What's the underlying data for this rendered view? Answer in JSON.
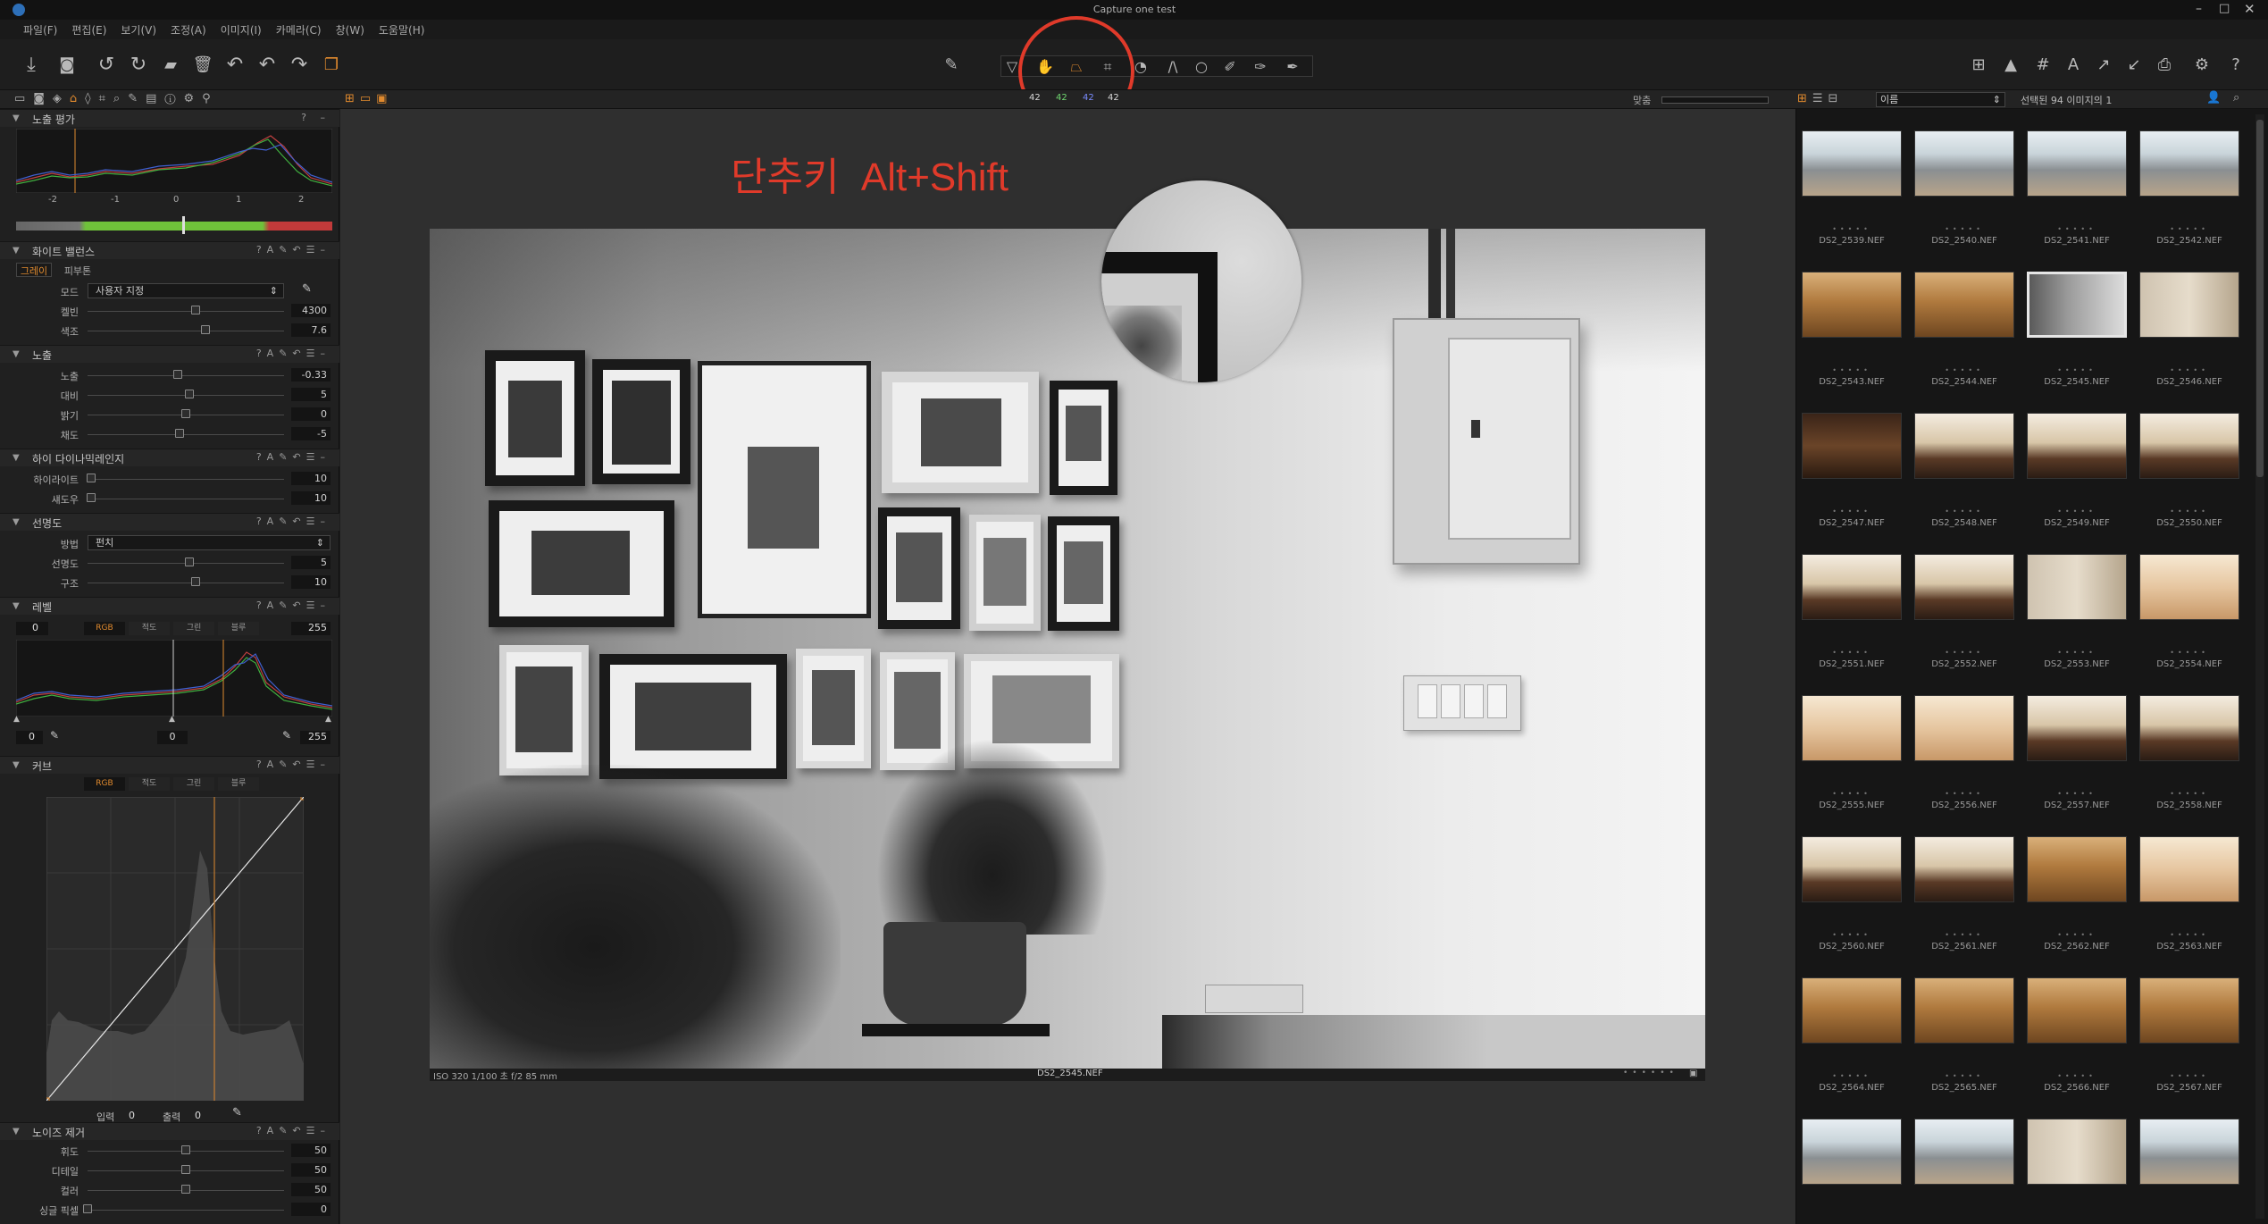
{
  "app": {
    "title": "Capture one test"
  },
  "menu": [
    "파일(F)",
    "편집(E)",
    "보기(V)",
    "조정(A)",
    "이미지(I)",
    "카메라(C)",
    "창(W)",
    "도움말(H)"
  ],
  "cursor_readouts": [
    "42",
    "42",
    "42",
    "42"
  ],
  "overlay_text": "단추키  Alt+Shift",
  "colors": {
    "accent": "#e08a2e",
    "annotation_red": "#e03a2a",
    "panel_bg": "#202020",
    "viewer_bg": "#2f2f2f"
  },
  "left_panel": {
    "exposure_eval": {
      "title": "노출 평가",
      "scale": [
        "-2",
        "-1",
        "0",
        "1",
        "2"
      ]
    },
    "white_balance": {
      "title": "화이트 밸런스",
      "tabs": [
        "그레이",
        "피부톤"
      ],
      "mode_label": "모드",
      "mode_value": "사용자 지정",
      "rows": [
        {
          "label": "켈빈",
          "value": "4300",
          "pos": 0.55
        },
        {
          "label": "색조",
          "value": "7.6",
          "pos": 0.6
        }
      ]
    },
    "exposure": {
      "title": "노출",
      "rows": [
        {
          "label": "노출",
          "value": "-0.33",
          "pos": 0.46
        },
        {
          "label": "대비",
          "value": "5",
          "pos": 0.52
        },
        {
          "label": "밝기",
          "value": "0",
          "pos": 0.5
        },
        {
          "label": "채도",
          "value": "-5",
          "pos": 0.47
        }
      ]
    },
    "hdr": {
      "title": "하이 다이나믹레인지",
      "rows": [
        {
          "label": "하이라이트",
          "value": "10",
          "pos": 0.02
        },
        {
          "label": "섀도우",
          "value": "10",
          "pos": 0.02
        }
      ]
    },
    "clarity": {
      "title": "선명도",
      "method_label": "방법",
      "method_value": "펀치",
      "rows": [
        {
          "label": "선명도",
          "value": "5",
          "pos": 0.52
        },
        {
          "label": "구조",
          "value": "10",
          "pos": 0.55
        }
      ]
    },
    "levels": {
      "title": "레벨",
      "channels": [
        "RGB",
        "적도",
        "그린",
        "블루"
      ],
      "left_value": "0",
      "right_value": "255",
      "mid_value": "0",
      "right_bottom_value": "255",
      "left_bottom_value": "0"
    },
    "curve": {
      "title": "커브",
      "channels": [
        "RGB",
        "적도",
        "그린",
        "블루"
      ],
      "input_label": "입력",
      "input_value": "0",
      "output_label": "출력",
      "output_value": "0"
    },
    "noise": {
      "title": "노이즈 제거",
      "rows": [
        {
          "label": "휘도",
          "value": "50",
          "pos": 0.5
        },
        {
          "label": "디테일",
          "value": "50",
          "pos": 0.5
        },
        {
          "label": "컬러",
          "value": "50",
          "pos": 0.5
        },
        {
          "label": "싱글 픽셀",
          "value": "0",
          "pos": 0.0
        }
      ]
    }
  },
  "viewer": {
    "proof_label": "맞춤",
    "exif": "ISO 320  1/100 초  f/2  85 mm",
    "filename": "DS2_2545.NEF"
  },
  "browser": {
    "sort_label": "이름",
    "count_text": "선택된 94 이미지의 1",
    "thumbnails": [
      {
        "name": "DS2_2539.NEF",
        "tone": "street"
      },
      {
        "name": "DS2_2540.NEF",
        "tone": "street"
      },
      {
        "name": "DS2_2541.NEF",
        "tone": "street"
      },
      {
        "name": "DS2_2542.NEF",
        "tone": "street"
      },
      {
        "name": "DS2_2543.NEF",
        "tone": "warm"
      },
      {
        "name": "DS2_2544.NEF",
        "tone": "warm"
      },
      {
        "name": "DS2_2545.NEF",
        "tone": "mono"
      },
      {
        "name": "DS2_2546.NEF",
        "tone": "wall"
      },
      {
        "name": "DS2_2547.NEF",
        "tone": "dark"
      },
      {
        "name": "DS2_2548.NEF",
        "tone": "cafe"
      },
      {
        "name": "DS2_2549.NEF",
        "tone": "cafe"
      },
      {
        "name": "DS2_2550.NEF",
        "tone": "cafe"
      },
      {
        "name": "DS2_2551.NEF",
        "tone": "cafe"
      },
      {
        "name": "DS2_2552.NEF",
        "tone": "cafe"
      },
      {
        "name": "DS2_2553.NEF",
        "tone": "wall"
      },
      {
        "name": "DS2_2554.NEF",
        "tone": "blur"
      },
      {
        "name": "DS2_2555.NEF",
        "tone": "blur"
      },
      {
        "name": "DS2_2556.NEF",
        "tone": "blur"
      },
      {
        "name": "DS2_2557.NEF",
        "tone": "cafe"
      },
      {
        "name": "DS2_2558.NEF",
        "tone": "cafe"
      },
      {
        "name": "DS2_2560.NEF",
        "tone": "cafe"
      },
      {
        "name": "DS2_2561.NEF",
        "tone": "cafe"
      },
      {
        "name": "DS2_2562.NEF",
        "tone": "warm"
      },
      {
        "name": "DS2_2563.NEF",
        "tone": "blur"
      },
      {
        "name": "DS2_2564.NEF",
        "tone": "warm"
      },
      {
        "name": "DS2_2565.NEF",
        "tone": "warm"
      },
      {
        "name": "DS2_2566.NEF",
        "tone": "warm"
      },
      {
        "name": "DS2_2567.NEF",
        "tone": "warm"
      },
      {
        "name": "",
        "tone": "street"
      },
      {
        "name": "",
        "tone": "street"
      },
      {
        "name": "",
        "tone": "wall"
      },
      {
        "name": "",
        "tone": "street"
      }
    ]
  }
}
